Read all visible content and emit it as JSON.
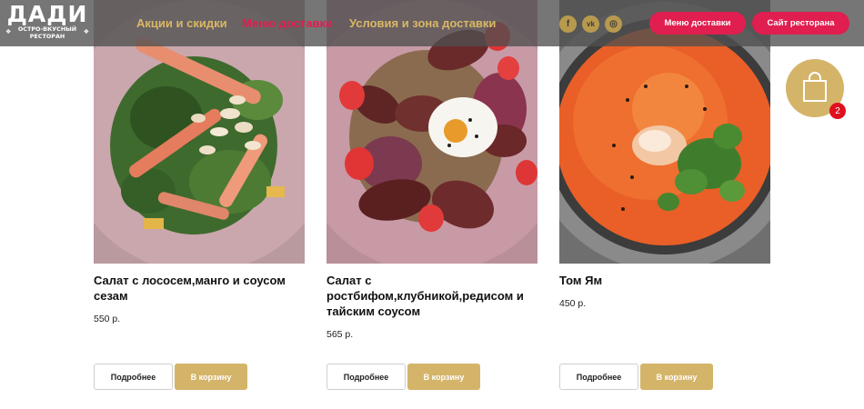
{
  "header": {
    "logo": {
      "main": "ДАДИ",
      "sub1": "ОСТРО-ВКУСНЫЙ",
      "sub2": "РЕСТОРАН"
    },
    "nav": [
      {
        "label": "Акции и скидки",
        "color": "#d9b764"
      },
      {
        "label": "Меню доставки",
        "color": "#e01e4f",
        "active": true
      },
      {
        "label": "Условия и зона доставки",
        "color": "#d9b764"
      }
    ],
    "social": [
      {
        "icon": "facebook-icon",
        "glyph": "f"
      },
      {
        "icon": "vk-icon",
        "glyph": "vk"
      },
      {
        "icon": "instagram-icon",
        "glyph": "◎"
      }
    ],
    "buttons": {
      "delivery_menu": "Меню доставки",
      "restaurant_site": "Сайт ресторана"
    }
  },
  "products": [
    {
      "title": "Салат с лососем,манго и соусом сезам",
      "price": "550 р.",
      "more_label": "Подробнее",
      "cart_label": "В корзину",
      "image": "salmon-mango-salad"
    },
    {
      "title": "Салат с ростбифом,клубникой,редисом и тайским соусом",
      "price": "565 р.",
      "more_label": "Подробнее",
      "cart_label": "В корзину",
      "image": "roastbeef-strawberry-salad"
    },
    {
      "title": "Том Ям",
      "price": "450 р.",
      "more_label": "Подробнее",
      "cart_label": "В корзину",
      "image": "tom-yum-soup"
    }
  ],
  "cart": {
    "count": "2",
    "icon": "shopping-bag-icon"
  },
  "colors": {
    "accent_gold": "#d4b469",
    "accent_red": "#e01e4f",
    "header_bg": "#505050"
  }
}
